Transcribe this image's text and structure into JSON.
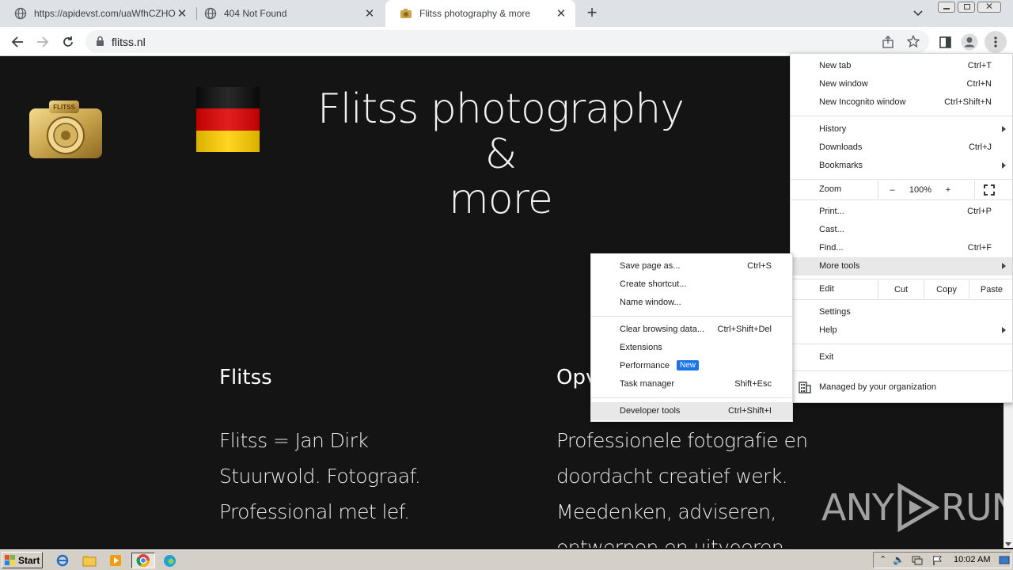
{
  "browser": {
    "tabs": [
      {
        "title": "https://apidevst.com/uaWfhCZHOIP",
        "active": false
      },
      {
        "title": "404 Not Found",
        "active": false
      },
      {
        "title": "Flitss photography & more",
        "active": true
      }
    ],
    "new_tab_symbol": "+",
    "address": "flitss.nl"
  },
  "page": {
    "title_line1": "Flitss photography &",
    "title_line2": "more",
    "logo_text": "FLITSS",
    "col1_heading": "Flitss",
    "col1_lines": [
      "Flitss = Jan Dirk",
      "Stuurwold. Fotograaf.",
      "Professional met lef."
    ],
    "col2_heading": "Opv",
    "col2_lines": [
      "Professionele fotografie en",
      "doordacht creatief werk.",
      "Meedenken, adviseren,",
      "ontwerpen en uitvoeren."
    ],
    "watermark_left": "ANY",
    "watermark_right": "RUN"
  },
  "chrome_menu": {
    "new_tab": {
      "label": "New tab",
      "shortcut": "Ctrl+T"
    },
    "new_window": {
      "label": "New window",
      "shortcut": "Ctrl+N"
    },
    "new_incognito": {
      "label": "New Incognito window",
      "shortcut": "Ctrl+Shift+N"
    },
    "history": {
      "label": "History"
    },
    "downloads": {
      "label": "Downloads",
      "shortcut": "Ctrl+J"
    },
    "bookmarks": {
      "label": "Bookmarks"
    },
    "zoom": {
      "label": "Zoom",
      "minus": "–",
      "value": "100%",
      "plus": "+"
    },
    "print": {
      "label": "Print...",
      "shortcut": "Ctrl+P"
    },
    "cast": {
      "label": "Cast..."
    },
    "find": {
      "label": "Find...",
      "shortcut": "Ctrl+F"
    },
    "more_tools": {
      "label": "More tools"
    },
    "edit": {
      "label": "Edit",
      "cut": "Cut",
      "copy": "Copy",
      "paste": "Paste"
    },
    "settings": {
      "label": "Settings"
    },
    "help": {
      "label": "Help"
    },
    "exit": {
      "label": "Exit"
    },
    "managed": {
      "label": "Managed by your organization"
    }
  },
  "more_tools_menu": {
    "save_page": {
      "label": "Save page as...",
      "shortcut": "Ctrl+S"
    },
    "create_shortcut": {
      "label": "Create shortcut..."
    },
    "name_window": {
      "label": "Name window..."
    },
    "clear_data": {
      "label": "Clear browsing data...",
      "shortcut": "Ctrl+Shift+Del"
    },
    "extensions": {
      "label": "Extensions"
    },
    "performance": {
      "label": "Performance",
      "badge": "New"
    },
    "task_manager": {
      "label": "Task manager",
      "shortcut": "Shift+Esc"
    },
    "dev_tools": {
      "label": "Developer tools",
      "shortcut": "Ctrl+Shift+I"
    }
  },
  "taskbar": {
    "start_label": "Start",
    "clock": "10:02 AM"
  },
  "colors": {
    "page_bg": "#141414",
    "menu_highlight": "#e8e8e8",
    "badge_blue": "#1a73e8",
    "logo_gold": "#c9a44c"
  }
}
